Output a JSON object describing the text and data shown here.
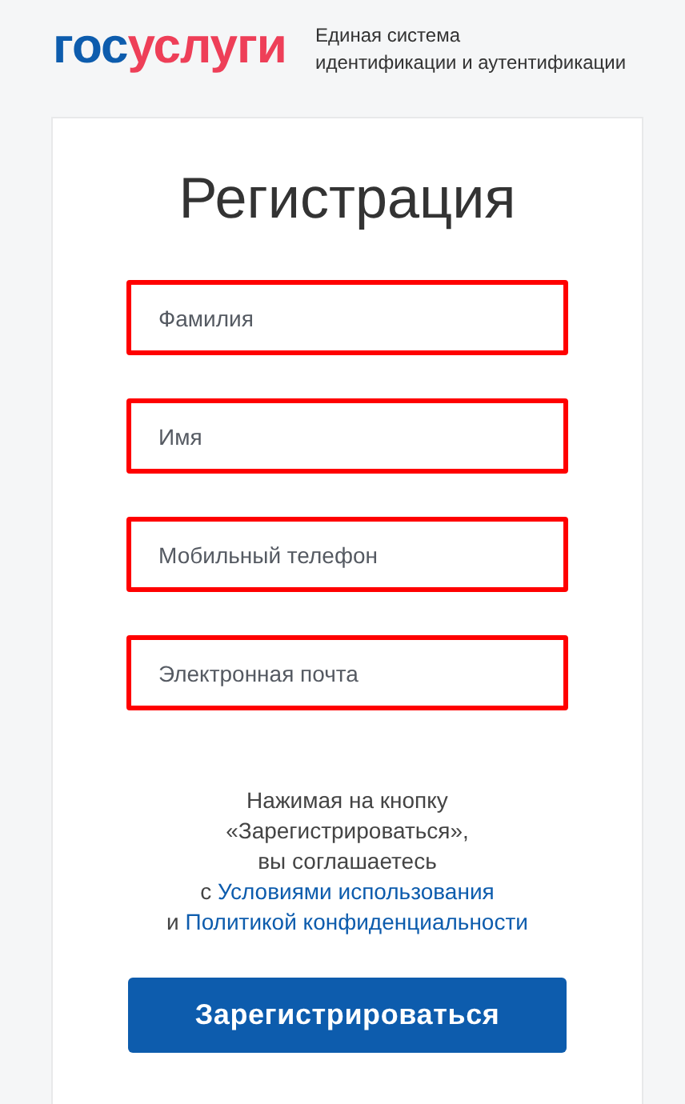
{
  "header": {
    "logo": [
      {
        "text": "гос",
        "color": "#0d5cad"
      },
      {
        "text": "услуги",
        "color": "#ee3f58"
      }
    ],
    "tagline": [
      "Единая система",
      "идентификации и аутентификации"
    ]
  },
  "form": {
    "title": "Регистрация",
    "fields": [
      {
        "placeholder": "Фамилия",
        "highlighted": true
      },
      {
        "placeholder": "Имя",
        "highlighted": true
      },
      {
        "placeholder": "Мобильный телефон",
        "highlighted": true
      },
      {
        "placeholder": "Электронная почта",
        "highlighted": true
      }
    ],
    "consent": {
      "lines": [
        "Нажимая на кнопку",
        "«Зарегистрироваться»,",
        "вы соглашаетесь"
      ],
      "terms_prefix": "с",
      "terms_link": "Условиями использования",
      "privacy_prefix": "и",
      "privacy_link": "Политикой конфиденциальности"
    },
    "submit": "Зарегистрироваться"
  }
}
